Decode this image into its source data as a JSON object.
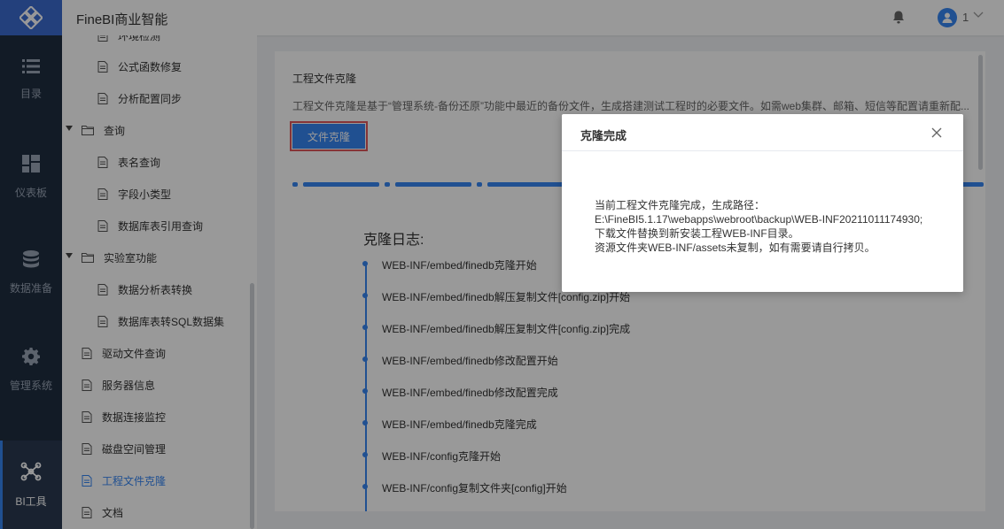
{
  "header": {
    "app_title": "FineBI商业智能",
    "user_number": "1"
  },
  "leftnav": {
    "items": [
      {
        "label": "目录",
        "icon": "list-icon"
      },
      {
        "label": "仪表板",
        "icon": "dashboard-icon"
      },
      {
        "label": "数据准备",
        "icon": "database-icon"
      },
      {
        "label": "管理系统",
        "icon": "gear-icon"
      },
      {
        "label": "BI工具",
        "icon": "tools-icon",
        "active": true
      }
    ]
  },
  "tree": {
    "items": [
      {
        "label": "环境检测",
        "type": "doc"
      },
      {
        "label": "公式函数修复",
        "type": "doc"
      },
      {
        "label": "分析配置同步",
        "type": "doc"
      },
      {
        "label": "查询",
        "type": "folder"
      },
      {
        "label": "表名查询",
        "type": "doc"
      },
      {
        "label": "字段小类型",
        "type": "doc"
      },
      {
        "label": "数据库表引用查询",
        "type": "doc"
      },
      {
        "label": "实验室功能",
        "type": "folder"
      },
      {
        "label": "数据分析表转换",
        "type": "doc"
      },
      {
        "label": "数据库表转SQL数据集",
        "type": "doc"
      },
      {
        "label": "驱动文件查询",
        "type": "doc"
      },
      {
        "label": "服务器信息",
        "type": "doc"
      },
      {
        "label": "数据连接监控",
        "type": "doc"
      },
      {
        "label": "磁盘空间管理",
        "type": "doc"
      },
      {
        "label": "工程文件克隆",
        "type": "doc",
        "selected": true
      },
      {
        "label": "文档",
        "type": "doc"
      }
    ]
  },
  "main": {
    "title": "工程文件克隆",
    "description": "工程文件克隆是基于“管理系统-备份还原”功能中最近的备份文件，生成搭建测试工程时的必要文件。如需web集群、邮箱、短信等配置请重新配...",
    "clone_button": "文件克隆",
    "log_title": "克隆日志:",
    "logs": [
      "WEB-INF/embed/finedb克隆开始",
      "WEB-INF/embed/finedb解压复制文件[config.zip]开始",
      "WEB-INF/embed/finedb解压复制文件[config.zip]完成",
      "WEB-INF/embed/finedb修改配置开始",
      "WEB-INF/embed/finedb修改配置完成",
      "WEB-INF/embed/finedb克隆完成",
      "WEB-INF/config克隆开始",
      "WEB-INF/config复制文件夹[config]开始"
    ]
  },
  "modal": {
    "title": "克隆完成",
    "lines": [
      "当前工程文件克隆完成，生成路径：",
      "E:\\FineBI5.1.17\\webapps\\webroot\\backup\\WEB-INF20211011174930;",
      "下载文件替换到新安装工程WEB-INF目录。",
      "资源文件夹WEB-INF/assets未复制，如有需要请自行拷贝。"
    ]
  },
  "colors": {
    "accent": "#3685f2",
    "nav_bg": "#1f2d40",
    "logo_bg": "#3b6ccf",
    "highlight_border": "#e0585d"
  }
}
